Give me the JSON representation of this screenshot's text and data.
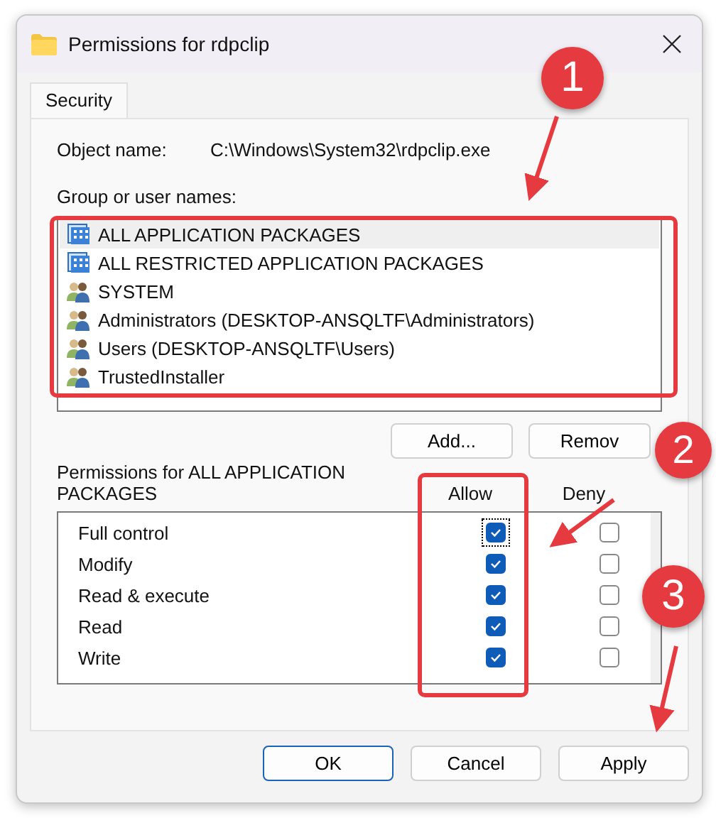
{
  "window": {
    "title": "Permissions for rdpclip"
  },
  "tabs": [
    {
      "label": "Security",
      "selected": true
    }
  ],
  "object_name": {
    "label": "Object name:",
    "value": "C:\\Windows\\System32\\rdpclip.exe"
  },
  "groups": {
    "label": "Group or user names:",
    "items": [
      {
        "name": "ALL APPLICATION PACKAGES",
        "kind": "package",
        "selected": true
      },
      {
        "name": "ALL RESTRICTED APPLICATION PACKAGES",
        "kind": "package",
        "selected": false
      },
      {
        "name": "SYSTEM",
        "kind": "users",
        "selected": false
      },
      {
        "name": "Administrators (DESKTOP-ANSQLTF\\Administrators)",
        "kind": "users",
        "selected": false
      },
      {
        "name": "Users (DESKTOP-ANSQLTF\\Users)",
        "kind": "users",
        "selected": false
      },
      {
        "name": "TrustedInstaller",
        "kind": "users",
        "selected": false
      }
    ]
  },
  "group_buttons": [
    "Add...",
    "Remov"
  ],
  "permissions": {
    "label": "Permissions for ALL APPLICATION PACKAGES",
    "columns": [
      "Allow",
      "Deny"
    ],
    "rows": [
      {
        "name": "Full control",
        "allow": true,
        "deny": false,
        "focused": true
      },
      {
        "name": "Modify",
        "allow": true,
        "deny": false,
        "focused": false
      },
      {
        "name": "Read & execute",
        "allow": true,
        "deny": false,
        "focused": false
      },
      {
        "name": "Read",
        "allow": true,
        "deny": false,
        "focused": false
      },
      {
        "name": "Write",
        "allow": true,
        "deny": false,
        "focused": false
      }
    ]
  },
  "buttons": [
    {
      "label": "OK",
      "kind": "default"
    },
    {
      "label": "Cancel",
      "kind": "normal"
    },
    {
      "label": "Apply",
      "kind": "normal"
    }
  ],
  "annotations": [
    {
      "label": "1"
    },
    {
      "label": "2"
    },
    {
      "label": "3"
    }
  ]
}
